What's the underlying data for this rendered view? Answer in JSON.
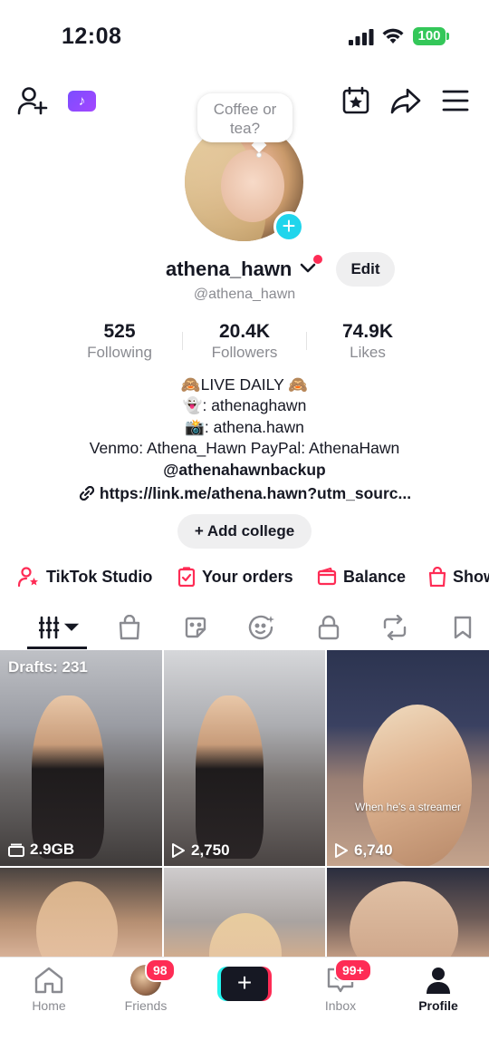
{
  "status_bar": {
    "time": "12:08",
    "battery": "100"
  },
  "note": {
    "text_line1": "Coffee or",
    "text_line2": "tea?"
  },
  "profile": {
    "username": "athena_hawn",
    "handle": "@athena_hawn",
    "edit_label": "Edit"
  },
  "stats": [
    {
      "value": "525",
      "label": "Following"
    },
    {
      "value": "20.4K",
      "label": "Followers"
    },
    {
      "value": "74.9K",
      "label": "Likes"
    }
  ],
  "bio": {
    "line1": "🙈LIVE DAILY 🙈",
    "line2": "👻: athenaghawn",
    "line3": "📸: athena.hawn",
    "line4": "Venmo: Athena_Hawn PayPal: AthenaHawn",
    "line5": "@athenahawnbackup",
    "link": "https://link.me/athena.hawn?utm_sourc..."
  },
  "add_college": "+ Add college",
  "quick_actions": [
    {
      "label": "TikTok Studio",
      "icon": "person-star-icon"
    },
    {
      "label": "Your orders",
      "icon": "orders-icon"
    },
    {
      "label": "Balance",
      "icon": "wallet-icon"
    },
    {
      "label": "Show",
      "icon": "bag-icon"
    }
  ],
  "tabs": [
    "videos-grid-icon",
    "shop-icon",
    "sticker-icon",
    "face-spark-icon",
    "lock-icon",
    "repost-icon",
    "bookmark-icon"
  ],
  "grid": {
    "drafts_label": "Drafts: 231",
    "cells": [
      {
        "label": "2.9GB"
      },
      {
        "label": "2,750"
      },
      {
        "label": "6,740",
        "caption": "When he's a streamer"
      }
    ]
  },
  "bottom_nav": {
    "home": "Home",
    "friends": "Friends",
    "friends_badge": "98",
    "inbox": "Inbox",
    "inbox_badge": "99+",
    "profile": "Profile"
  },
  "colors": {
    "accent_red": "#fe2c55",
    "accent_cyan": "#20d5ec",
    "text": "#161823",
    "muted": "#8a8b91"
  }
}
